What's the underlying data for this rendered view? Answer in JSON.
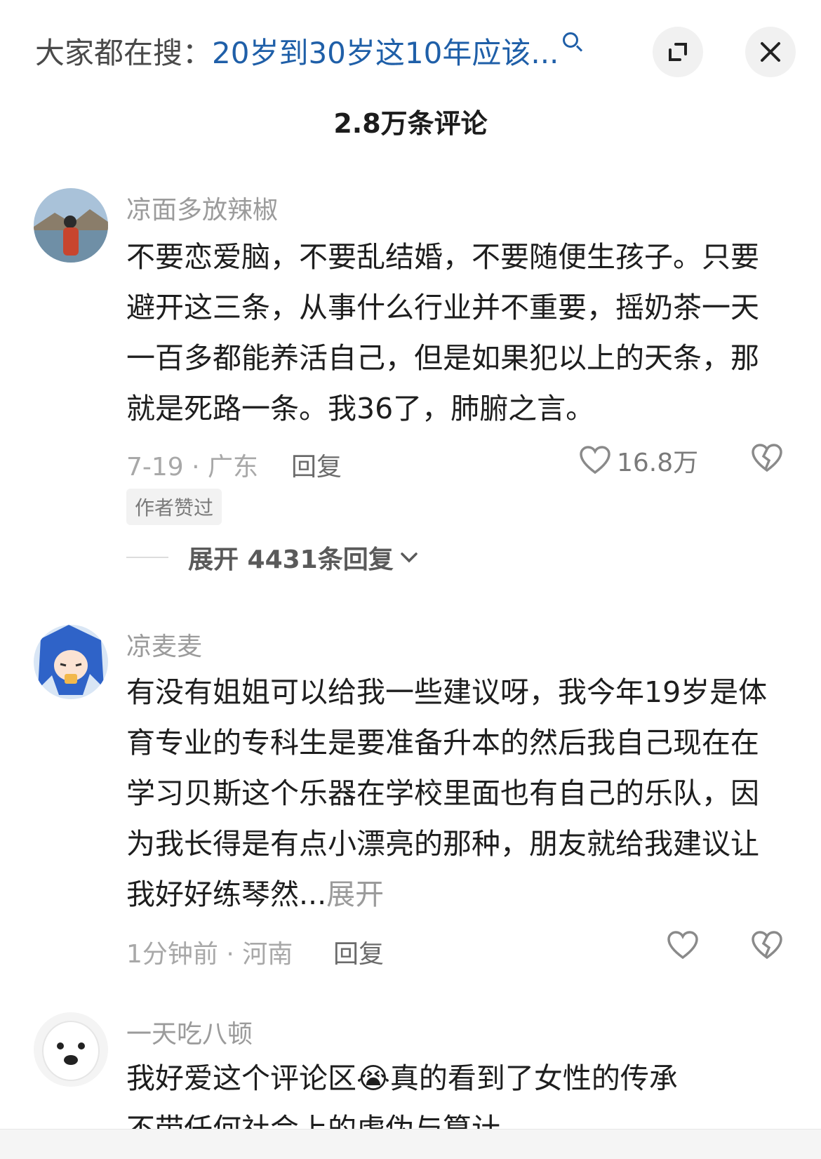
{
  "header": {
    "search_prefix": "大家都在搜：",
    "search_query": "20岁到30岁这10年应该...",
    "comment_count": "2.8万条评论"
  },
  "comments": [
    {
      "name": "凉面多放辣椒",
      "text": "不要恋爱脑，不要乱结婚，不要随便生孩子。只要避开这三条，从事什么行业并不重要，摇奶茶一天一百多都能养活自己，但是如果犯以上的天条，那就是死路一条。我36了，肺腑之言。",
      "meta": "7-19 · 广东",
      "reply": "回复",
      "likes": "16.8万",
      "tag": "作者赞过",
      "expand": "展开 4431条回复"
    },
    {
      "name": "凉麦麦",
      "text": "有没有姐姐可以给我一些建议呀，我今年19岁是体育专业的专科生是要准备升本的然后我自己现在在学习贝斯这个乐器在学校里面也有自己的乐队，因为我长得是有点小漂亮的那种，朋友就给我建议让我好好练琴然...",
      "more": "展开",
      "meta": "1分钟前 · 河南",
      "reply": "回复"
    },
    {
      "name": "一天吃八顿",
      "text": "我好爱这个评论区😭真的看到了女性的传承",
      "text2": "不带任何社会上的虚伪与算计"
    }
  ]
}
